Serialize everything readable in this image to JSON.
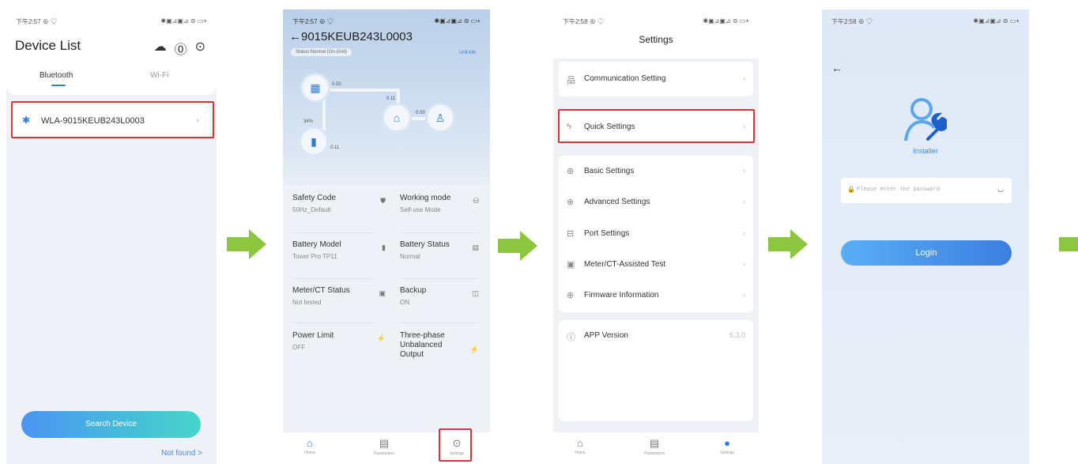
{
  "phone1": {
    "status_time": "下午2:57 ⊕ ♡",
    "status_right": "✱▣⊿▣⊿ ⊜ ▭+",
    "title": "Device List",
    "icons": [
      "cloud-icon",
      "help-icon",
      "more-icon"
    ],
    "tabs": [
      "Bluetooth",
      "Wi-Fi"
    ],
    "device_name": "WLA-9015KEUB243L0003",
    "search_button": "Search Device",
    "not_found": "Not found >"
  },
  "phone2": {
    "status_time": "下午2:57 ⊕ ♡",
    "status_right": "✱▣⊿▣⊿ ⊜ ▭+",
    "title": "←9015KEUB243L0003",
    "status_pill": "Status:Normal (On-Grid)",
    "unit": "Unit:kW",
    "flow": {
      "pv": "0.00",
      "grid": "0.11",
      "load": "0.00",
      "battery_pct": "34%",
      "battery": "0.11"
    },
    "grid": [
      {
        "label": "Safety Code",
        "value": "50Hz_Default"
      },
      {
        "label": "Working mode",
        "value": "Self-use Mode"
      },
      {
        "label": "Battery Model",
        "value": "Tower Pro TP11"
      },
      {
        "label": "Battery Status",
        "value": "Normal"
      },
      {
        "label": "Meter/CT Status",
        "value": "Not tested"
      },
      {
        "label": "Backup",
        "value": "ON"
      },
      {
        "label": "Power Limit",
        "value": "OFF"
      },
      {
        "label": "Three-phase Unbalanced Output",
        "value": ""
      }
    ],
    "nav": [
      "Home",
      "Parameters",
      "Settings"
    ]
  },
  "phone3": {
    "status_time": "下午2:58 ⊕ ♡",
    "status_right": "✱▣⊿▣⊿ ⊜ ▭+",
    "title": "Settings",
    "items": [
      "Communication Setting",
      "Quick Settings",
      "Basic Settings",
      "Advanced Settings",
      "Port Settings",
      "Meter/CT-Assisted Test",
      "Firmware Information"
    ],
    "app_version_label": "APP Version",
    "app_version": "5.3.0",
    "nav": [
      "Home",
      "Parameters",
      "Settings"
    ]
  },
  "phone4": {
    "status_time": "下午2:58 ⊕ ♡",
    "status_right": "✱▣⊿▣⊿ ⊜ ▭+",
    "role": "Installer",
    "password_placeholder": "Please enter the password",
    "login": "Login"
  },
  "colors": {
    "accent": "#2b7de9",
    "arrow": "#8cc63f",
    "highlight": "#d93535"
  }
}
